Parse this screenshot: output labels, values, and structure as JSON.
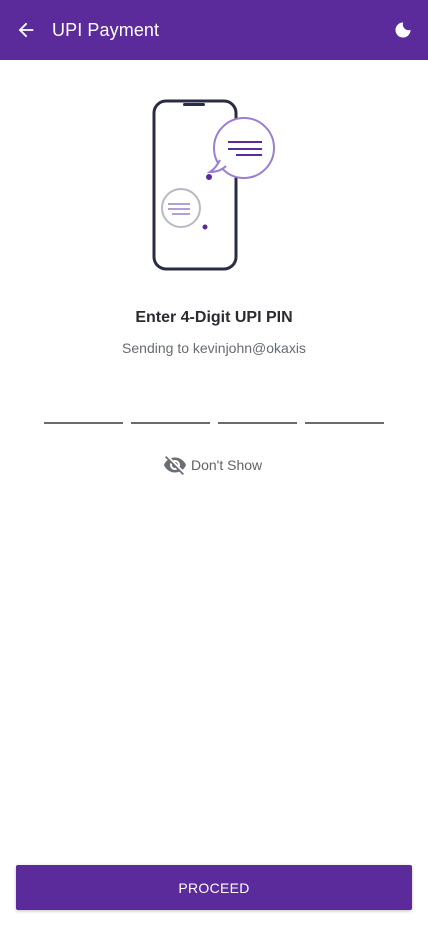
{
  "colors": {
    "primary": "#5b2a9b",
    "accent_light": "#9a7fd1",
    "text_dark": "#2b2b33",
    "text_muted": "#666a73"
  },
  "header": {
    "back_icon": "arrow-left-icon",
    "title": "UPI Payment",
    "theme_icon": "moon-icon"
  },
  "illustration": {
    "icon": "phone-chat-illustration"
  },
  "pin": {
    "title": "Enter 4-Digit UPI PIN",
    "subtitle": "Sending to kevinjohn@okaxis",
    "digits": [
      "",
      "",
      "",
      ""
    ],
    "toggle_icon": "eye-off-icon",
    "toggle_label": "Don't Show"
  },
  "footer": {
    "proceed_label": "PROCEED"
  }
}
